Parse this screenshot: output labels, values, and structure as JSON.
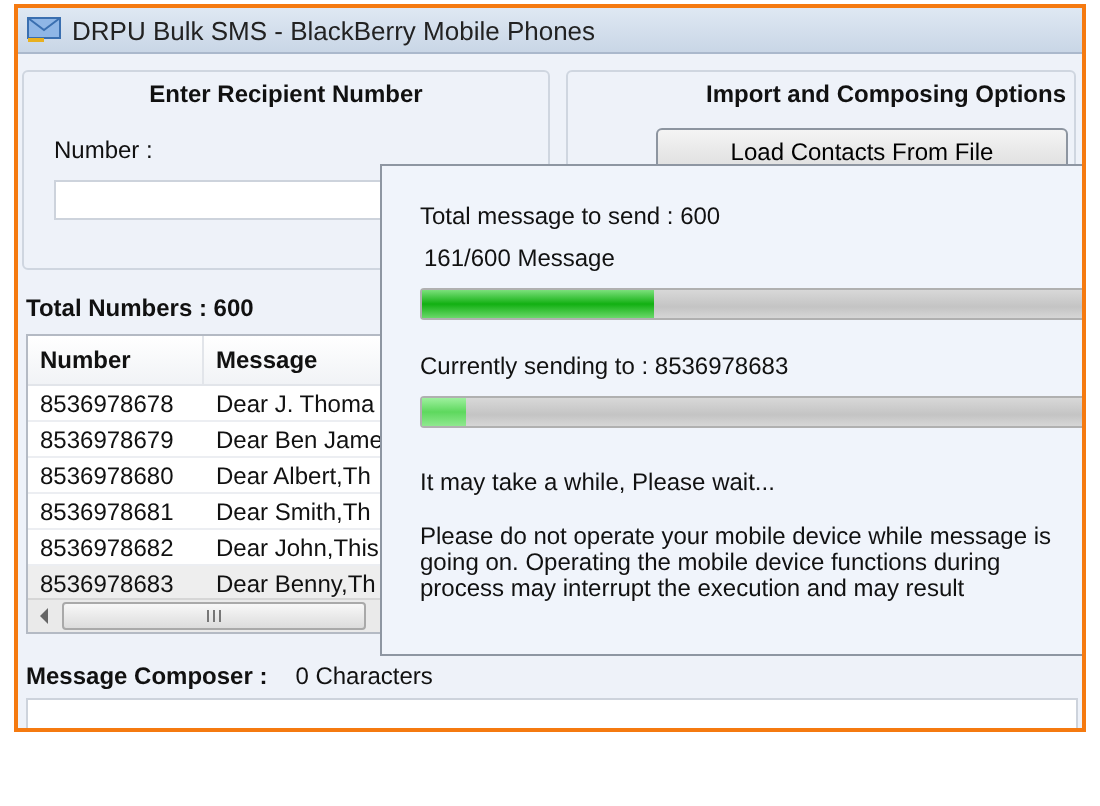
{
  "window": {
    "title": "DRPU Bulk SMS - BlackBerry Mobile Phones"
  },
  "recipient_group": {
    "title": "Enter Recipient Number",
    "number_label": "Number :"
  },
  "import_group": {
    "title": "Import and Composing Options",
    "buttons": [
      "Load Contacts From File"
    ]
  },
  "total_numbers": "Total Numbers : 600",
  "table": {
    "columns": [
      "Number",
      "Message"
    ],
    "rows": [
      {
        "number": "8536978678",
        "message": "Dear J. Thoma",
        "selected": false
      },
      {
        "number": "8536978679",
        "message": "Dear Ben Jame",
        "selected": false
      },
      {
        "number": "8536978680",
        "message": "Dear Albert,Th",
        "selected": false
      },
      {
        "number": "8536978681",
        "message": "Dear Smith,Th",
        "selected": false
      },
      {
        "number": "8536978682",
        "message": "Dear John,This",
        "selected": false
      },
      {
        "number": "8536978683",
        "message": "Dear Benny,Th",
        "selected": true
      }
    ]
  },
  "composer": {
    "label": "Message Composer :",
    "count": "0 Characters"
  },
  "progress_dialog": {
    "total": "Total message to send : 600",
    "count": "161/600 Message",
    "overall_bar": {
      "level": 0.35
    },
    "current": "Currently sending to : 8536978683",
    "current_bar": {
      "level": 0.065
    },
    "wait": "It may take a while, Please wait...",
    "warning": "Please do not operate your mobile device while message is going on. Operating the mobile device functions during process may interrupt the execution and may result"
  }
}
